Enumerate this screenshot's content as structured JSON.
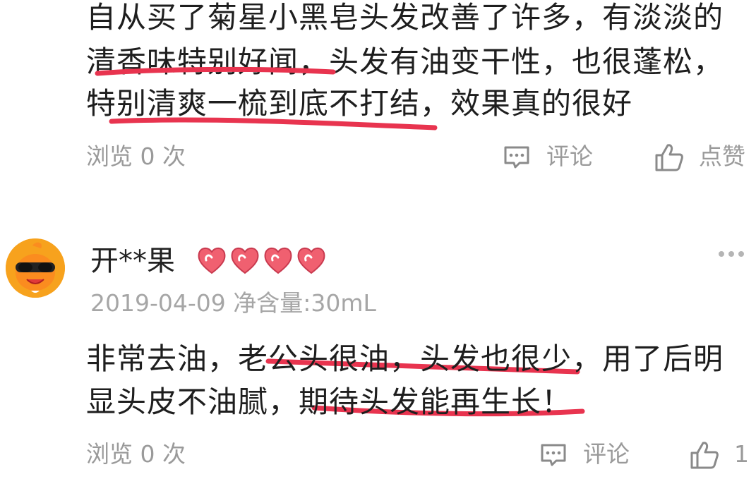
{
  "review1": {
    "lines": [
      "自从买了菊星小黑皂头发改善了许多，有淡淡的",
      "清香味特别好闻，头发有油变干性，也很蓬松，",
      "特别清爽一梳到底不打结，效果真的很好"
    ],
    "views_label": "浏览 0 次",
    "comment_label": "评论",
    "like_label": "点赞"
  },
  "review2": {
    "username": "开**果",
    "date": "2019-04-09",
    "variant": "净含量:30mL",
    "lines": [
      "非常去油，老公头很油，头发也很少，用了后明",
      "显头皮不油腻，期待头发能再生长！"
    ],
    "views_label": "浏览 0 次",
    "comment_label": "评论",
    "like_count": "1"
  },
  "colors": {
    "underline": "#e8344f",
    "meta_text": "#9a9a9a",
    "avatar_bg": "#f7a21d",
    "heart": "#f06070"
  },
  "icons": {
    "comment": "comment-bubble-icon",
    "like": "thumbs-up-icon",
    "more": "more-dots-icon",
    "badge": "heart-badge-icon"
  }
}
